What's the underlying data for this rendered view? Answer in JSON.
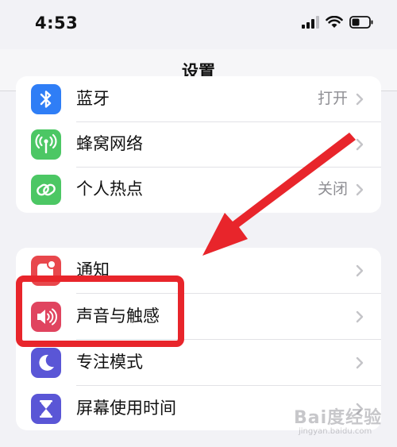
{
  "status_bar": {
    "time": "4:53"
  },
  "nav": {
    "title": "设置"
  },
  "groups": [
    {
      "rows": [
        {
          "label": "蓝牙",
          "value": "打开",
          "icon": "bluetooth-icon",
          "color": "#2f7ef6"
        },
        {
          "label": "蜂窝网络",
          "value": "",
          "icon": "cellular-antenna-icon",
          "color": "#4cc764"
        },
        {
          "label": "个人热点",
          "value": "关闭",
          "icon": "hotspot-link-icon",
          "color": "#4cc764"
        }
      ]
    },
    {
      "rows": [
        {
          "label": "通知",
          "value": "",
          "icon": "notification-icon",
          "color": "#e8474c"
        },
        {
          "label": "声音与触感",
          "value": "",
          "icon": "speaker-icon",
          "color": "#e0445f"
        },
        {
          "label": "专注模式",
          "value": "",
          "icon": "moon-icon",
          "color": "#5a56d6"
        },
        {
          "label": "屏幕使用时间",
          "value": "",
          "icon": "hourglass-icon",
          "color": "#5a56d6"
        }
      ]
    }
  ],
  "watermark": {
    "brand": "Bai度经验",
    "url": "jingyan.baidu.com"
  }
}
